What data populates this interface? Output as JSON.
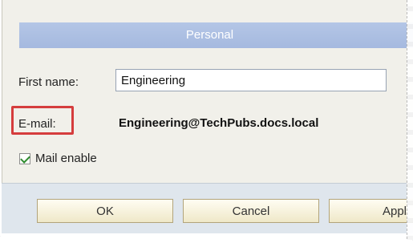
{
  "dialog": {
    "header_title": "Personal",
    "fields": {
      "first_name_label": "First name:",
      "first_name_value": "Engineering",
      "email_label": "E-mail:",
      "email_value": "Engineering@TechPubs.docs.local"
    },
    "mail_enable": {
      "label": "Mail enable",
      "checked": true
    },
    "buttons": {
      "ok": "OK",
      "cancel": "Cancel",
      "apply": "Appl"
    },
    "colors": {
      "header_blue": "#a5b9df",
      "highlight_red": "#d53d3d",
      "check_green": "#2e8b2e"
    }
  }
}
